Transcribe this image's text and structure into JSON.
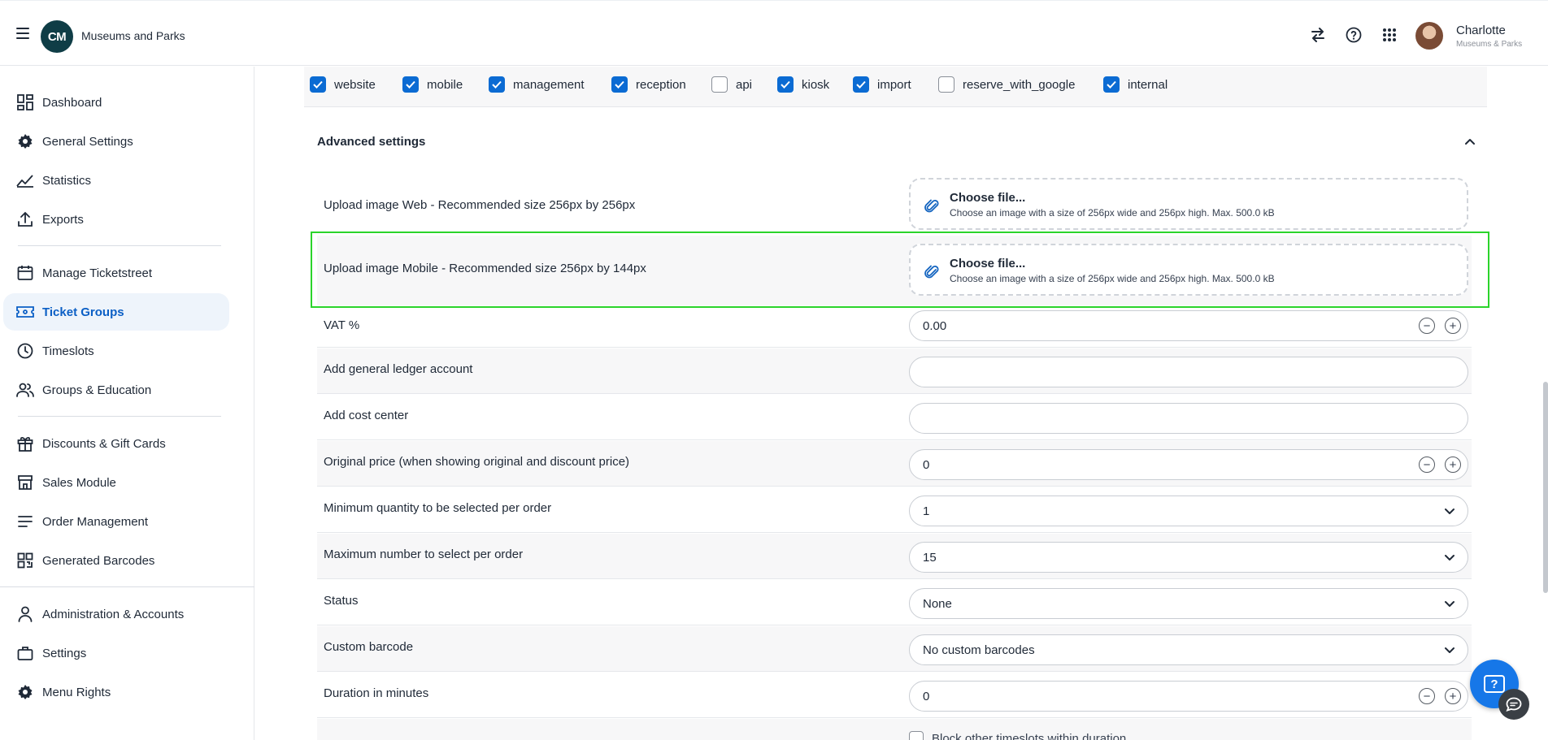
{
  "header": {
    "app_title": "Museums and Parks",
    "logo_text": "CM",
    "user_name": "Charlotte",
    "user_org": "Museums & Parks",
    "icons": [
      "menu-icon",
      "swap-icon",
      "help-circle-icon",
      "apps-grid-icon"
    ]
  },
  "sidebar": {
    "items": [
      {
        "label": "Dashboard",
        "icon": "dashboard-icon"
      },
      {
        "label": "General Settings",
        "icon": "gear-icon"
      },
      {
        "label": "Statistics",
        "icon": "chart-line-icon"
      },
      {
        "label": "Exports",
        "icon": "upload-icon"
      },
      {
        "label": "Manage Ticketstreet",
        "icon": "calendar-icon"
      },
      {
        "label": "Ticket Groups",
        "icon": "ticket-icon",
        "active": true
      },
      {
        "label": "Timeslots",
        "icon": "clock-icon"
      },
      {
        "label": "Groups & Education",
        "icon": "people-icon"
      },
      {
        "label": "Discounts & Gift Cards",
        "icon": "gift-icon"
      },
      {
        "label": "Sales Module",
        "icon": "store-icon"
      },
      {
        "label": "Order Management",
        "icon": "list-icon"
      },
      {
        "label": "Generated Barcodes",
        "icon": "qr-code-icon"
      },
      {
        "label": "Administration & Accounts",
        "icon": "person-icon"
      },
      {
        "label": "Settings",
        "icon": "briefcase-icon"
      },
      {
        "label": "Menu Rights",
        "icon": "gear-icon"
      }
    ]
  },
  "channels": [
    {
      "label": "website",
      "checked": true
    },
    {
      "label": "mobile",
      "checked": true
    },
    {
      "label": "management",
      "checked": true
    },
    {
      "label": "reception",
      "checked": true
    },
    {
      "label": "api",
      "checked": false
    },
    {
      "label": "kiosk",
      "checked": true
    },
    {
      "label": "import",
      "checked": true
    },
    {
      "label": "reserve_with_google",
      "checked": false
    },
    {
      "label": "internal",
      "checked": true
    }
  ],
  "advanced": {
    "title": "Advanced settings",
    "upload_web": {
      "label": "Upload image Web - Recommended size 256px by 256px",
      "button": "Choose file...",
      "hint": "Choose an image with a size of 256px wide and 256px high. Max. 500.0 kB"
    },
    "upload_mobile": {
      "label": "Upload image Mobile - Recommended size 256px by 144px",
      "button": "Choose file...",
      "hint": "Choose an image with a size of 256px wide and 256px high. Max. 500.0 kB"
    },
    "vat": {
      "label": "VAT %",
      "value": "0.00"
    },
    "ledger": {
      "label": "Add general ledger account",
      "value": ""
    },
    "cost_center": {
      "label": "Add cost center",
      "value": ""
    },
    "original_price": {
      "label": "Original price (when showing original and discount price)",
      "value": "0"
    },
    "min_qty": {
      "label": "Minimum quantity to be selected per order",
      "value": "1"
    },
    "max_qty": {
      "label": "Maximum number to select per order",
      "value": "15"
    },
    "status": {
      "label": "Status",
      "value": "None"
    },
    "custom_barcode": {
      "label": "Custom barcode",
      "value": "No custom barcodes"
    },
    "duration": {
      "label": "Duration in minutes",
      "value": "0"
    },
    "block_other": {
      "label": "Block other timeslots within duration"
    }
  },
  "widgets": {
    "help_label": "?"
  },
  "colors": {
    "accent": "#0b6bd3",
    "active_nav_bg": "#eef4fb",
    "highlight": "#2bd42b",
    "help_button": "#1677e8"
  }
}
